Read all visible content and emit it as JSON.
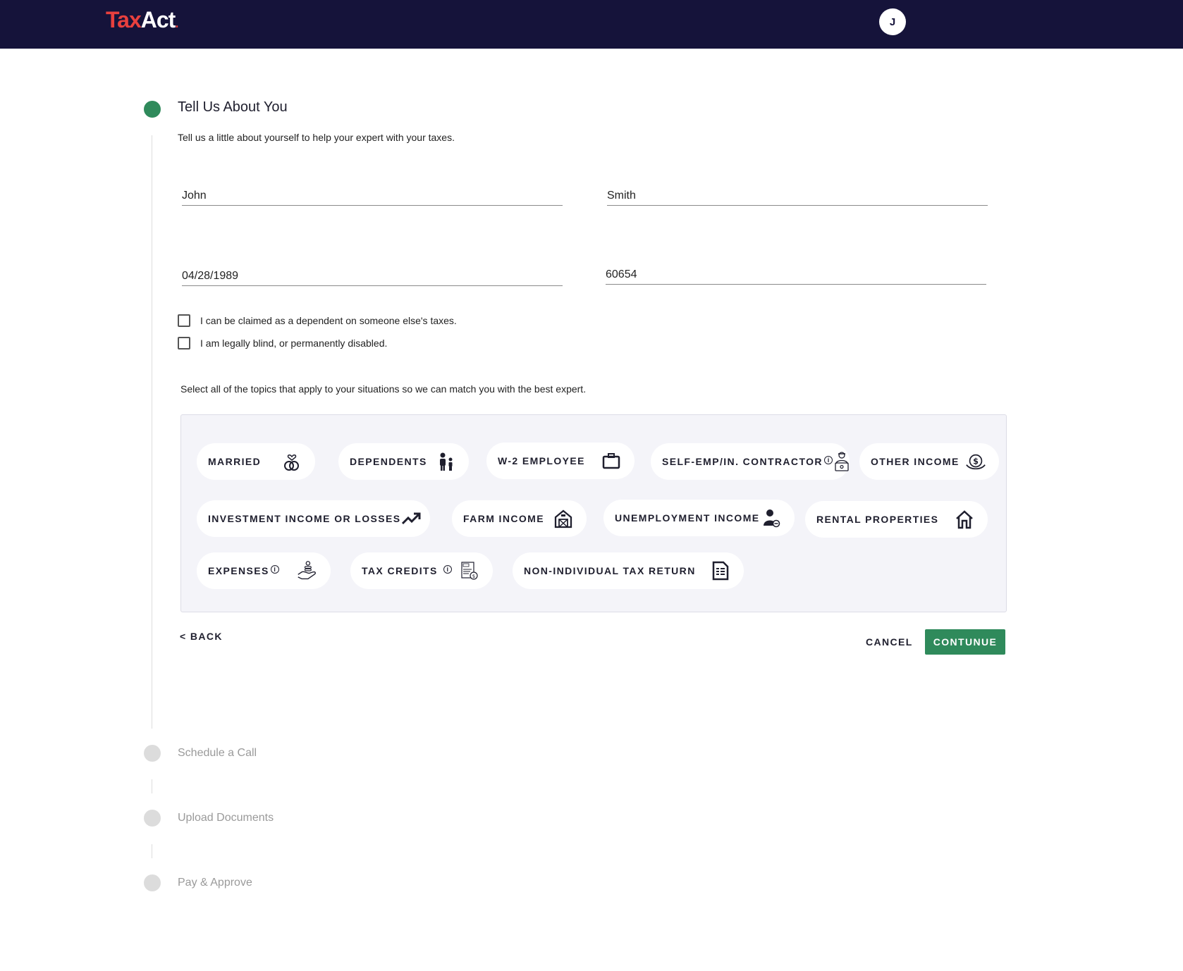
{
  "header": {
    "logo_tax": "Tax",
    "logo_act": "Act",
    "logo_dot": ".",
    "avatar_initial": "J"
  },
  "steps": [
    {
      "label": "Tell Us About You",
      "active": true
    },
    {
      "label": "Schedule a Call",
      "active": false
    },
    {
      "label": "Upload Documents",
      "active": false
    },
    {
      "label": "Pay & Approve",
      "active": false
    }
  ],
  "form": {
    "subtitle": "Tell us a little about yourself to help your expert with your taxes.",
    "first_name": "John",
    "last_name": "Smith",
    "dob": "04/28/1989",
    "zip": "60654",
    "checkboxes": [
      {
        "label": "I can be claimed as a dependent on someone else's taxes.",
        "checked": false
      },
      {
        "label": "I am legally blind, or permanently disabled.",
        "checked": false
      }
    ],
    "topics_intro": "Select all of the topics that apply to your situations so we can match you with the best expert."
  },
  "topics": [
    {
      "label": "MARRIED",
      "icon": "rings-icon",
      "info": false
    },
    {
      "label": "DEPENDENTS",
      "icon": "family-icon",
      "info": false
    },
    {
      "label": "W-2 EMPLOYEE",
      "icon": "briefcase-icon",
      "info": false
    },
    {
      "label": "SELF-EMP/IN. CONTRACTOR",
      "icon": "contractor-laptop-icon",
      "info": true
    },
    {
      "label": "OTHER INCOME",
      "icon": "money-bag-icon",
      "info": false
    },
    {
      "label": "INVESTMENT INCOME OR LOSSES",
      "icon": "trending-up-icon",
      "info": false
    },
    {
      "label": "FARM INCOME",
      "icon": "barn-icon",
      "info": false
    },
    {
      "label": "UNEMPLOYMENT INCOME",
      "icon": "person-minus-icon",
      "info": false
    },
    {
      "label": "RENTAL PROPERTIES",
      "icon": "house-icon",
      "info": false
    },
    {
      "label": "EXPENSES",
      "icon": "hand-coins-icon",
      "info": true
    },
    {
      "label": "TAX CREDITS",
      "icon": "tax-form-icon",
      "info": true
    },
    {
      "label": "NON-INDIVIDUAL TAX RETURN",
      "icon": "document-icon",
      "info": false
    }
  ],
  "info_symbol": "i",
  "actions": {
    "back": "< BACK",
    "cancel": "CANCEL",
    "continue": "CONTUNUE"
  },
  "colors": {
    "header_bg": "#15133a",
    "accent_green": "#2f8a5b",
    "logo_red": "#e8403e"
  }
}
